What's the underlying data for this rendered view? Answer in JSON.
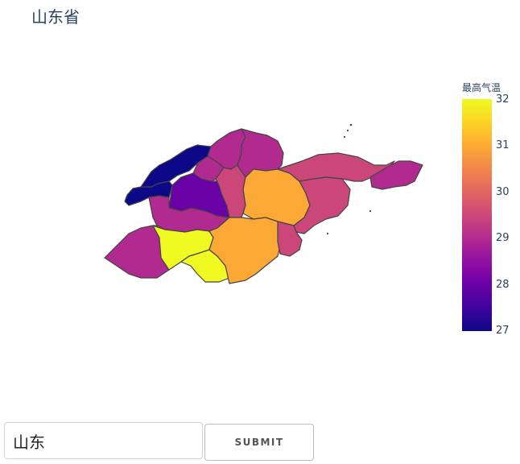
{
  "title": "山东省",
  "colorbar": {
    "title": "最高气温",
    "min": 27,
    "max": 32,
    "ticks": [
      "32",
      "31",
      "30",
      "29",
      "28",
      "27"
    ],
    "colorscale": [
      "#0d0887",
      "#46039f",
      "#7201a8",
      "#9c179e",
      "#bd3786",
      "#d8576b",
      "#ed7953",
      "#fb9f3a",
      "#fdca26",
      "#f0f921"
    ]
  },
  "search": {
    "value": "山东",
    "submit_label": "SUBMIT"
  },
  "chart_data": {
    "type": "choropleth",
    "region": "山东省",
    "value_label": "最高气温",
    "range": [
      27,
      32
    ],
    "regions": [
      {
        "value": 27.0
      },
      {
        "value": 27.0
      },
      {
        "value": 29.0
      },
      {
        "value": 29.0
      },
      {
        "value": 29.0
      },
      {
        "value": 28.0
      },
      {
        "value": 29.0
      },
      {
        "value": 29.5
      },
      {
        "value": 31.0
      },
      {
        "value": 29.5
      },
      {
        "value": 29.0
      },
      {
        "value": 29.5
      },
      {
        "value": 29.0
      },
      {
        "value": 32.0
      },
      {
        "value": 32.0
      },
      {
        "value": 31.0
      },
      {
        "value": 29.5
      }
    ]
  }
}
